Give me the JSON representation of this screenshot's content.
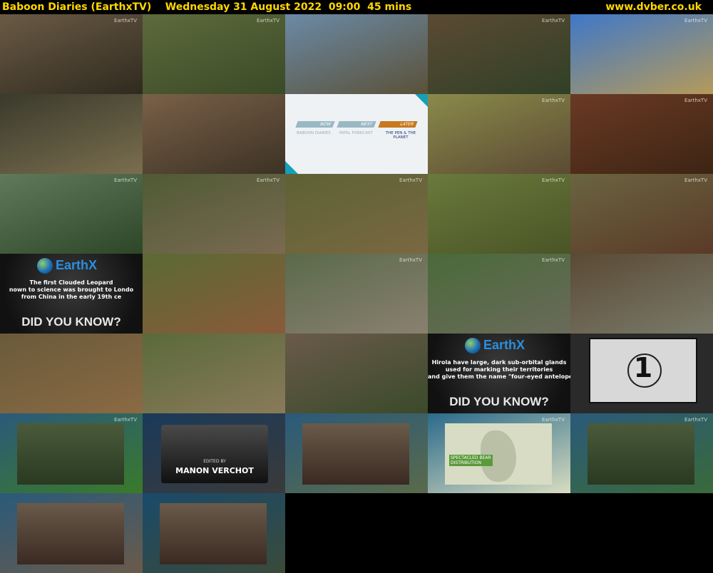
{
  "header": {
    "title": "Baboon Diaries (EarthxTV)    Wednesday 31 August 2022  09:00  45 mins",
    "site": "www.dvber.co.uk"
  },
  "tiles": [
    {
      "scene": "baboon-on-rock-slope",
      "bg": "#6a5a44",
      "accent": "#2f2a1f",
      "bug": "EarthxTV"
    },
    {
      "scene": "green-hillside",
      "bg": "#5d6a3c",
      "accent": "#3a4a26",
      "bug": "EarthxTV"
    },
    {
      "scene": "man-sitting-on-cliff",
      "bg": "#6b8aa6",
      "accent": "#5a5138",
      "bug": ""
    },
    {
      "scene": "bush-landscape",
      "bg": "#5b4a33",
      "accent": "#304026",
      "bug": "EarthxTV"
    },
    {
      "scene": "savanna-road",
      "bg": "#3f78c8",
      "accent": "#b59a5a",
      "bug": "EarthxTV"
    },
    {
      "scene": "fence-wire-baboon",
      "bg": "#3a3a2c",
      "accent": "#7a6e4e",
      "bug": ""
    },
    {
      "scene": "grassland-field",
      "bg": "#7a6048",
      "accent": "#3c3224",
      "bug": ""
    },
    {
      "scene": "schedule-card",
      "bg": "#eaeef0",
      "accent": "#16a0b8",
      "bug": ""
    },
    {
      "scene": "baboon-in-grass",
      "bg": "#8a8a4a",
      "accent": "#5b4a34",
      "bug": "EarthxTV"
    },
    {
      "scene": "baboon-red-soil",
      "bg": "#6a3a24",
      "accent": "#3d2414",
      "bug": "EarthxTV"
    },
    {
      "scene": "baboon-walking-hills",
      "bg": "#5f7a5a",
      "accent": "#2e4628",
      "bug": "EarthxTV"
    },
    {
      "scene": "baboon-in-tree",
      "bg": "#4f5a34",
      "accent": "#7a6a52",
      "bug": "EarthxTV"
    },
    {
      "scene": "baboons-troop",
      "bg": "#5d6234",
      "accent": "#7a6842",
      "bug": "EarthxTV"
    },
    {
      "scene": "baboon-grass-meadow",
      "bg": "#6a7a3c",
      "accent": "#4a5426",
      "bug": "EarthxTV"
    },
    {
      "scene": "dry-bush-ground",
      "bg": "#6a6440",
      "accent": "#5a3a28",
      "bug": "EarthxTV"
    },
    {
      "scene": "did-you-know-leopard",
      "bg": "#141414",
      "accent": "#3a8ee0",
      "bug": ""
    },
    {
      "scene": "baboon-walking-dirt",
      "bg": "#5a6a34",
      "accent": "#8a5a3a",
      "bug": ""
    },
    {
      "scene": "rocky-outcrop",
      "bg": "#5a6a4a",
      "accent": "#8a8070",
      "bug": "EarthxTV"
    },
    {
      "scene": "baboon-closeup-grass",
      "bg": "#4a6a3a",
      "accent": "#6a6a5a",
      "bug": "EarthxTV"
    },
    {
      "scene": "baboon-with-infant",
      "bg": "#5a4a34",
      "accent": "#7a7a6a",
      "bug": ""
    },
    {
      "scene": "baboon-face-closeup",
      "bg": "#6a5a3a",
      "accent": "#8a6a44",
      "bug": ""
    },
    {
      "scene": "baboon-foraging",
      "bg": "#5a6a3a",
      "accent": "#8a7a5a",
      "bug": ""
    },
    {
      "scene": "baboon-on-rocks",
      "bg": "#6a5a4a",
      "accent": "#3a4a2a",
      "bug": ""
    },
    {
      "scene": "did-you-know-hirola",
      "bg": "#1a1a1a",
      "accent": "#3a8ee0",
      "bug": ""
    },
    {
      "scene": "countdown-leader",
      "bg": "#2a2a2a",
      "accent": "#e8e8e8",
      "bug": ""
    },
    {
      "scene": "rainforest-frame",
      "bg": "#2a5a7a",
      "accent": "#3a7a2a",
      "bug": "EarthxTV"
    },
    {
      "scene": "edited-by-card",
      "bg": "#1a3a5a",
      "accent": "#3a3a3a",
      "bug": ""
    },
    {
      "scene": "presenter-plants",
      "bg": "#2a5a7a",
      "accent": "#5a6a4a",
      "bug": ""
    },
    {
      "scene": "map-south-america",
      "bg": "#2a6a8a",
      "accent": "#d8dcc0",
      "bug": "EarthxTV"
    },
    {
      "scene": "stream-in-forest",
      "bg": "#2a5a7a",
      "accent": "#3a6a3a",
      "bug": "EarthxTV"
    },
    {
      "scene": "presenter-room",
      "bg": "#2a5a7a",
      "accent": "#6a5a4a",
      "bug": ""
    },
    {
      "scene": "presenter-smiling",
      "bg": "#1a4a6a",
      "accent": "#3a4a3a",
      "bug": ""
    }
  ],
  "overlays": {
    "schedule": {
      "now_label": "NOW",
      "next_label": "NEXT",
      "later_label": "LATER",
      "now_title": "BABOON DIARIES",
      "next_title": "FATAL FORECAST",
      "later_title": "THE PEN & THE PLANET"
    },
    "dyk1": {
      "brand": "EarthX",
      "fact": "The first Clouded Leopard\nnown to science was brought to Londo\nfrom China in the early 19th ce",
      "banner": "DID YOU KNOW?"
    },
    "dyk2": {
      "brand": "EarthX",
      "fact": "Hirola have large, dark sub-orbital glands\nused for marking their territories\nand give them the name \"four-eyed antelope.\"",
      "banner": "DID YOU KNOW?"
    },
    "countdown": {
      "number": "1"
    },
    "credit": {
      "line1": "EDITED BY",
      "line2": "MANON VERCHOT"
    },
    "map": {
      "label": "SPECTACLED BEAR\nDISTRIBUTION"
    }
  }
}
